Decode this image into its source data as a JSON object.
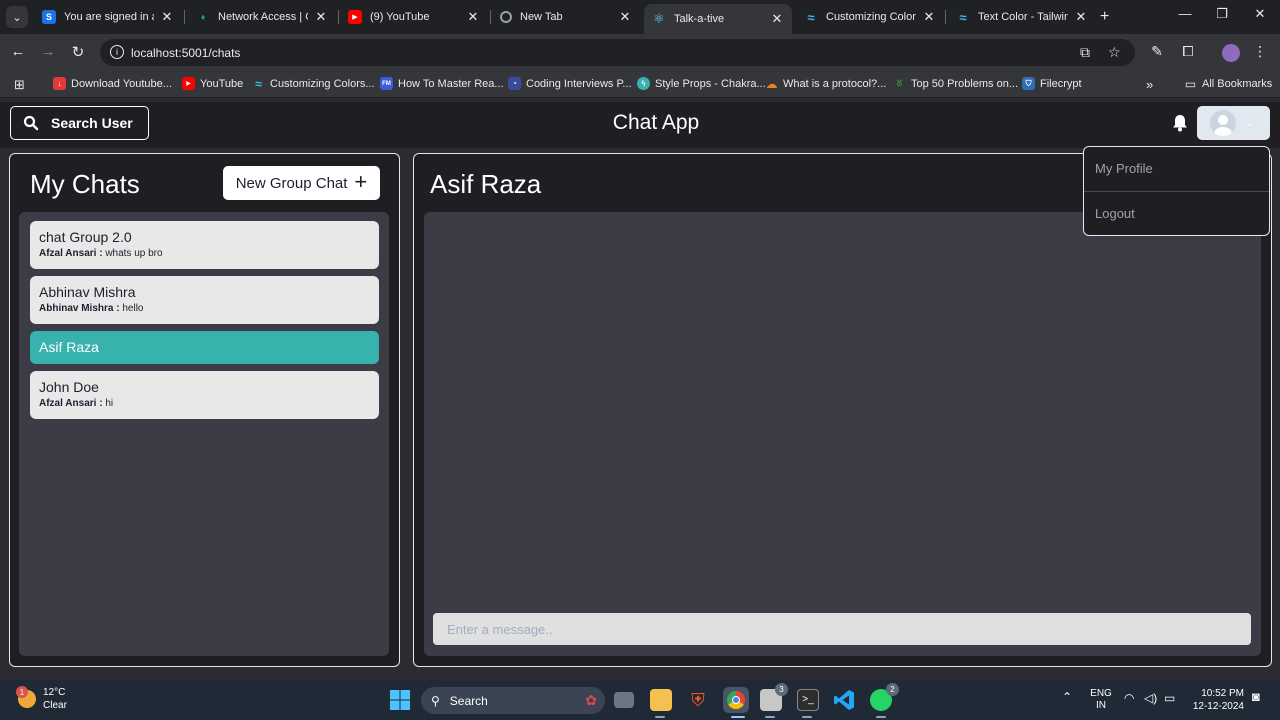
{
  "browser": {
    "tabs": [
      {
        "title": "You are signed in as",
        "favicon_color": "#1a73e8",
        "favicon_glyph": "S"
      },
      {
        "title": "Network Access | Clo",
        "favicon_color": "#13aa52",
        "favicon_glyph": "●"
      },
      {
        "title": "(9) YouTube",
        "favicon_color": "#ff0000",
        "favicon_glyph": "▶"
      },
      {
        "title": "New Tab",
        "favicon_color": "#5f6368",
        "favicon_glyph": "◎"
      },
      {
        "title": "Talk-a-tive",
        "favicon_color": "#61dafb",
        "favicon_glyph": "⚛"
      },
      {
        "title": "Customizing Colors",
        "favicon_color": "#38bdf8",
        "favicon_glyph": "≈"
      },
      {
        "title": "Text Color - Tailwind",
        "favicon_color": "#38bdf8",
        "favicon_glyph": "≈"
      }
    ],
    "active_tab": 4,
    "url": "localhost:5001/chats",
    "bookmarks": [
      {
        "label": "Download Youtube...",
        "favicon_color": "#e53935"
      },
      {
        "label": "YouTube",
        "favicon_color": "#ff0000"
      },
      {
        "label": "Customizing Colors...",
        "favicon_color": "#38bdf8"
      },
      {
        "label": "How To Master Rea...",
        "favicon_color": "#3b5bdb"
      },
      {
        "label": "Coding Interviews P...",
        "favicon_color": "#3b4a9b"
      },
      {
        "label": "Style Props - Chakra...",
        "favicon_color": "#38b2ac"
      },
      {
        "label": "What is a protocol?...",
        "favicon_color": "#f48024"
      },
      {
        "label": "Top 50 Problems on...",
        "favicon_color": "#2f8d46"
      },
      {
        "label": "Filecrypt",
        "favicon_color": "#2f6db5"
      }
    ],
    "all_bookmarks": "All Bookmarks"
  },
  "app": {
    "search_user": "Search User",
    "title": "Chat App",
    "my_chats": "My Chats",
    "new_group_chat": "New Group Chat",
    "chats": [
      {
        "name": "chat Group 2.0",
        "sender": "Afzal Ansari :",
        "message": "whats up bro",
        "selected": false
      },
      {
        "name": "Abhinav Mishra",
        "sender": "Abhinav Mishra :",
        "message": "hello",
        "selected": false
      },
      {
        "name": "Asif Raza",
        "sender": "",
        "message": "",
        "selected": true
      },
      {
        "name": "John Doe",
        "sender": "Afzal Ansari :",
        "message": "hi",
        "selected": false
      }
    ],
    "current_chat": "Asif Raza",
    "message_placeholder": "Enter a message..",
    "menu": {
      "my_profile": "My Profile",
      "logout": "Logout"
    },
    "accent_color": "#38b2ac"
  },
  "taskbar": {
    "weather_temp": "12°C",
    "weather_desc": "Clear",
    "weather_badge": "1",
    "search": "Search",
    "lang_top": "ENG",
    "lang_bottom": "IN",
    "time": "10:52 PM",
    "date": "12-12-2024",
    "whatsapp_badge": "2",
    "files_badge": "3"
  }
}
